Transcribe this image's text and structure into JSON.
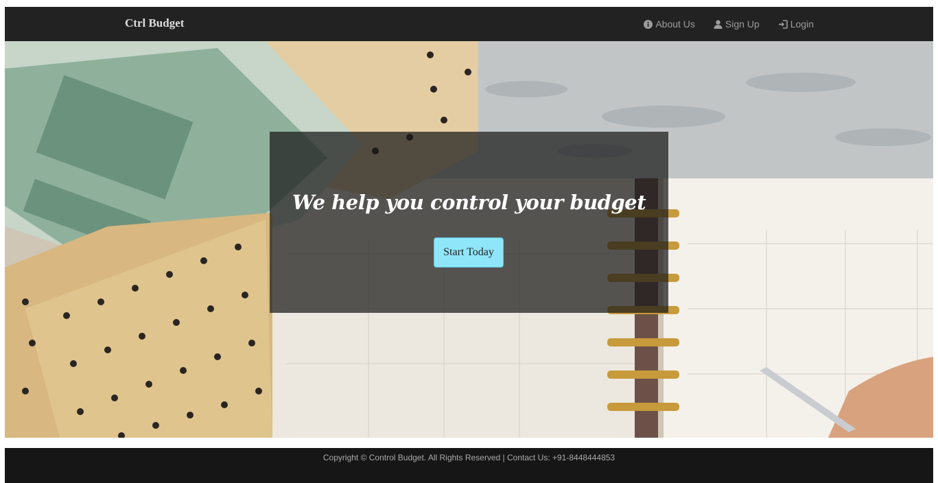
{
  "navbar": {
    "brand": "Ctrl Budget",
    "links": [
      {
        "label": "About Us",
        "icon": "info-circle-icon"
      },
      {
        "label": "Sign Up",
        "icon": "user-icon"
      },
      {
        "label": "Login",
        "icon": "login-icon"
      }
    ]
  },
  "hero": {
    "tagline": "We help you control your budget",
    "cta_label": "Start Today"
  },
  "footer": {
    "text": "Copyright © Control Budget. All Rights Reserved | Contact Us: +91-8448444853"
  },
  "colors": {
    "navbar_bg": "#222222",
    "footer_bg": "#161616",
    "cta_bg": "#8fe6f8",
    "nav_link": "#9d9d9d"
  }
}
